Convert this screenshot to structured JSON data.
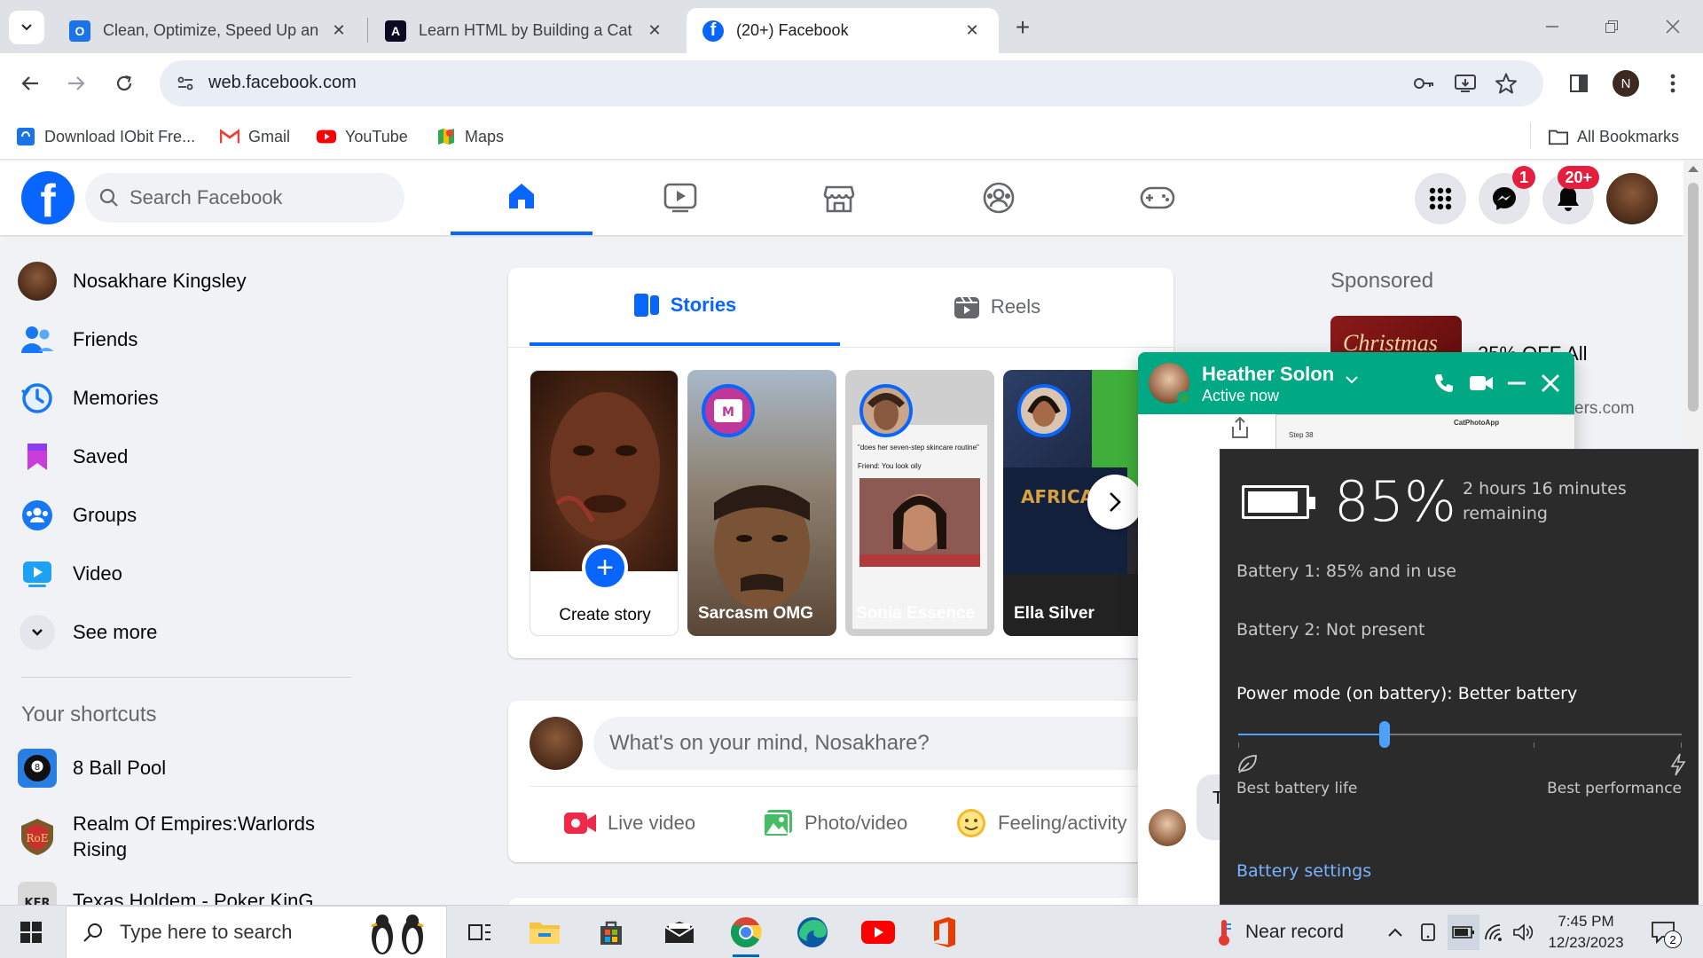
{
  "browser": {
    "tabs": [
      {
        "title": "Clean, Optimize, Speed Up and",
        "favicon_color": "#1a73e8",
        "favicon_char": "O"
      },
      {
        "title": "Learn HTML by Building a Cat P",
        "favicon_color": "#0a0a23",
        "favicon_char": "A"
      },
      {
        "title": "(20+) Facebook",
        "favicon_color": "#0866ff",
        "favicon_char": "f",
        "active": true
      }
    ],
    "url": "web.facebook.com",
    "profile_initial": "N",
    "bookmarks": [
      {
        "label": "Download IObit Fre...",
        "icon": "iobit-icon"
      },
      {
        "label": "Gmail",
        "icon": "gmail-icon"
      },
      {
        "label": "YouTube",
        "icon": "youtube-icon"
      },
      {
        "label": "Maps",
        "icon": "maps-icon"
      }
    ],
    "all_bookmarks": "All Bookmarks"
  },
  "facebook": {
    "search_placeholder": "Search Facebook",
    "messenger_badge": "1",
    "notifications_badge": "20+",
    "left_menu": [
      {
        "label": "Nosakhare Kingsley",
        "icon": "profile-avatar"
      },
      {
        "label": "Friends",
        "icon": "friends-icon"
      },
      {
        "label": "Memories",
        "icon": "memories-icon"
      },
      {
        "label": "Saved",
        "icon": "saved-icon"
      },
      {
        "label": "Groups",
        "icon": "groups-icon"
      },
      {
        "label": "Video",
        "icon": "video-icon"
      },
      {
        "label": "See more",
        "icon": "chevron-down-icon"
      }
    ],
    "shortcuts_heading": "Your shortcuts",
    "shortcuts": [
      {
        "label": "8 Ball Pool"
      },
      {
        "label": "Realm Of Empires:Warlords Rising"
      },
      {
        "label": "Texas Holdem - Poker KinG"
      }
    ],
    "stories_tabs": [
      {
        "label": "Stories",
        "icon": "stories-icon"
      },
      {
        "label": "Reels",
        "icon": "reels-icon"
      }
    ],
    "stories": [
      {
        "name": "Create story"
      },
      {
        "name": "Sarcasm OMG"
      },
      {
        "name": "Sonia Essence"
      },
      {
        "name": "Ella Silver"
      }
    ],
    "story_meme_text": "\"does her seven-step skincare routine\"",
    "story_meme_text2": "Friend: You look oily",
    "composer_placeholder": "What's on your mind, Nosakhare?",
    "composer_actions": [
      {
        "label": "Live video",
        "icon": "live-video-icon",
        "color": "#f02849"
      },
      {
        "label": "Photo/video",
        "icon": "photo-icon",
        "color": "#45bd62"
      },
      {
        "label": "Feeling/activity",
        "icon": "feeling-icon",
        "color": "#f7b928"
      }
    ],
    "sponsored_heading": "Sponsored",
    "ad_text": "25% OFF All",
    "ad_url": "ers.com",
    "ad_image_text": "Christmas"
  },
  "chat": {
    "name": "Heather Solon",
    "status": "Active now",
    "bubble_text": "T g",
    "thumb_text_left": "Step 38",
    "thumb_text_right": "CatPhotoApp"
  },
  "battery": {
    "percent": "85%",
    "remaining": "2 hours 16 minutes remaining",
    "battery1": "Battery 1: 85% and in use",
    "battery2": "Battery 2: Not present",
    "power_mode": "Power mode (on battery): Better battery",
    "slider_level": 0.33,
    "label_left": "Best battery life",
    "label_right": "Best performance",
    "settings_link": "Battery settings"
  },
  "taskbar": {
    "search_placeholder": "Type here to search",
    "weather": "Near record",
    "time": "7:45 PM",
    "date": "12/23/2023",
    "notification_count": "2"
  }
}
